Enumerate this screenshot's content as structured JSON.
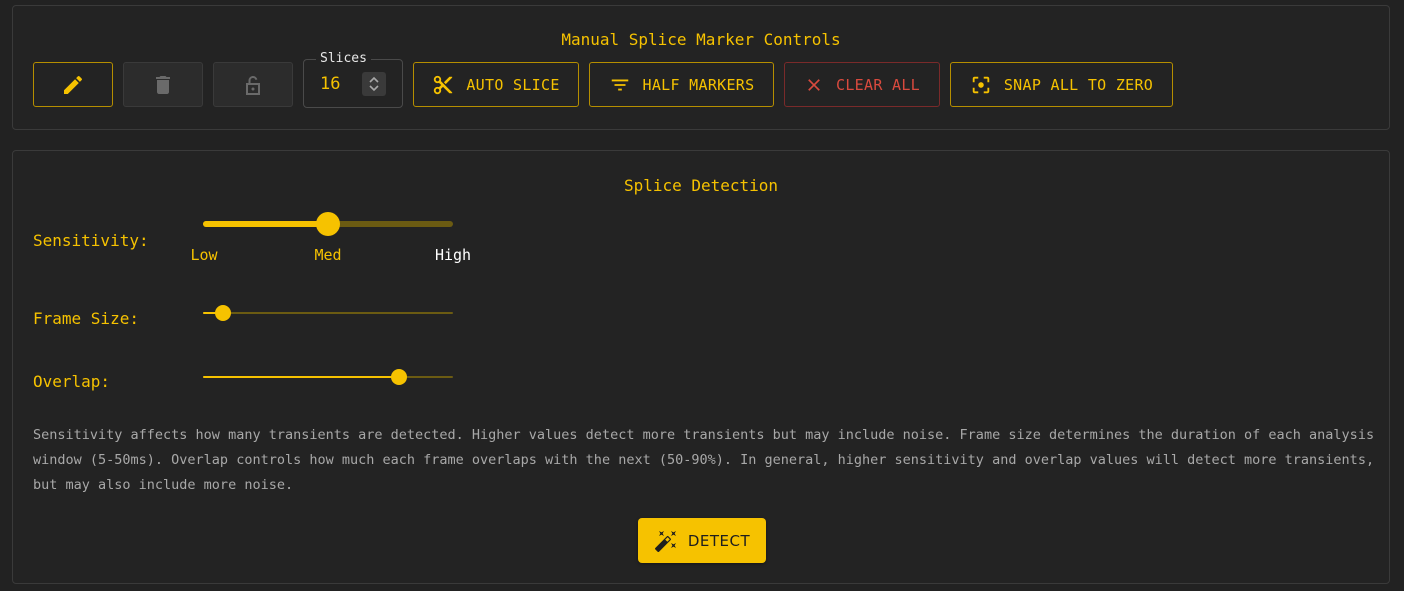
{
  "manual_controls": {
    "title": "Manual Splice Marker Controls",
    "edit_icon": "pencil-icon",
    "delete_icon": "trash-icon",
    "lock_icon": "unlock-icon",
    "slices": {
      "label": "Slices",
      "value": "16",
      "stepper_icon": "up-down-chevron-icon"
    },
    "auto_slice_label": "AUTO SLICE",
    "half_markers_label": "HALF MARKERS",
    "clear_all_label": "CLEAR ALL",
    "snap_zero_label": "SNAP ALL TO ZERO"
  },
  "detection": {
    "title": "Splice Detection",
    "sensitivity": {
      "label": "Sensitivity:",
      "value": 0.5,
      "marks": [
        "Low",
        "Med",
        "High"
      ]
    },
    "frame_size": {
      "label": "Frame Size:",
      "value": 0.08
    },
    "overlap": {
      "label": "Overlap:",
      "value": 0.785
    },
    "help_text": "Sensitivity affects how many transients are detected. Higher values detect more transients but may include noise. Frame size determines the duration of each analysis window (5-50ms). Overlap controls how much each frame overlaps with the next (50-90%). In general, higher sensitivity and overlap values will detect more transients, but may also include more noise.",
    "detect_label": "DETECT",
    "detect_icon": "magic-wand-icon"
  },
  "colors": {
    "accent": "#f6c200",
    "danger": "#d94a3e",
    "background": "#222222",
    "muted_text": "#a8a8a8"
  }
}
